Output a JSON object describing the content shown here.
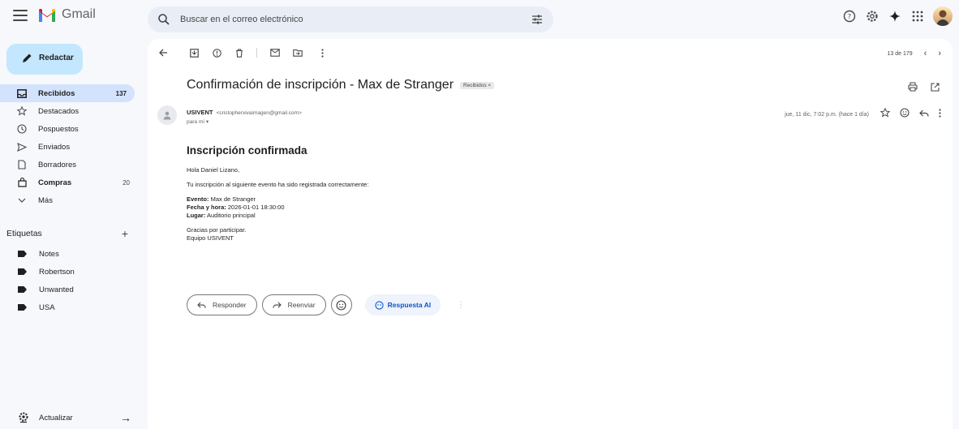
{
  "app": {
    "name": "Gmail"
  },
  "search": {
    "placeholder": "Buscar en el correo electrónico"
  },
  "sidebar": {
    "compose_label": "Redactar",
    "items": [
      {
        "label": "Recibidos",
        "count": "137",
        "icon": "inbox-icon",
        "active": true
      },
      {
        "label": "Destacados",
        "count": "",
        "icon": "star-icon"
      },
      {
        "label": "Pospuestos",
        "count": "",
        "icon": "clock-icon"
      },
      {
        "label": "Enviados",
        "count": "",
        "icon": "send-icon"
      },
      {
        "label": "Borradores",
        "count": "",
        "icon": "draft-icon"
      },
      {
        "label": "Compras",
        "count": "20",
        "icon": "shopping-bag-icon"
      },
      {
        "label": "Más",
        "count": "",
        "icon": "chevron-down-icon"
      }
    ],
    "labels_title": "Etiquetas",
    "labels": [
      "Notes",
      "Robertson",
      "Unwanted",
      "USA"
    ],
    "update_label": "Actualizar"
  },
  "toolbar": {
    "pager": "13 de 179"
  },
  "email": {
    "subject": "Confirmación de inscripción - Max de Stranger",
    "chip": "Recibidos ×",
    "sender_name": "USIVENT",
    "sender_email": "<cristopherxivaimagen@gmail.com>",
    "to": "para mí ▾",
    "date": "jue, 11 dic, 7:02 p.m. (hace 1 día)",
    "body": {
      "heading": "Inscripción confirmada",
      "greeting": "Hola Daniel Lizano,",
      "intro": "Tu inscripción al siguiente evento ha sido registrada correctamente:",
      "event_label": "Evento:",
      "event_value": " Max de Stranger",
      "datetime_label": "Fecha y hora:",
      "datetime_value": " 2026-01-01 18:30:00",
      "place_label": "Lugar:",
      "place_value": " Auditorio principal",
      "thanks": "Gracias por participar.",
      "signature": "Equipo USIVENT"
    }
  },
  "actions": {
    "reply": "Responder",
    "forward": "Reenviar",
    "ai_reply": "Respuesta AI"
  },
  "colors": {
    "background": "#f6f8fc",
    "compose": "#c2e7ff",
    "active_nav": "#d3e3fd",
    "accent": "#0b57d0"
  }
}
